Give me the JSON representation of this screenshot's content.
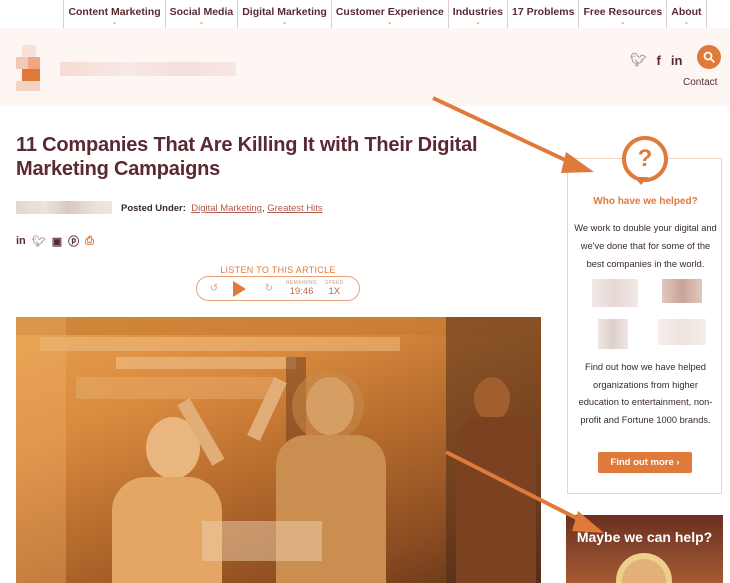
{
  "nav": {
    "items": [
      {
        "label": "Content Marketing"
      },
      {
        "label": "Social Media"
      },
      {
        "label": "Digital Marketing"
      },
      {
        "label": "Customer Experience"
      },
      {
        "label": "Industries"
      },
      {
        "label": "17 Problems"
      },
      {
        "label": "Free Resources"
      },
      {
        "label": "About"
      }
    ]
  },
  "header": {
    "contact_label": "Contact",
    "social_icons": [
      "twitter-icon",
      "facebook-icon",
      "linkedin-icon"
    ],
    "search_icon": "search-icon"
  },
  "article": {
    "title": "11 Companies That Are Killing It with Their Digital Marketing Campaigns",
    "posted_under_label": "Posted Under:",
    "categories": [
      "Digital Marketing",
      "Greatest Hits"
    ],
    "category_separator": ",",
    "share_icons": [
      "linkedin-icon",
      "twitter-icon",
      "facebook-icon",
      "pinterest-icon",
      "print-icon"
    ]
  },
  "player": {
    "listen_label": "LISTEN TO THIS ARTICLE",
    "remaining_label": "REMAINING",
    "remaining_value": "19:46",
    "speed_label": "SPEED",
    "speed_value": "1X"
  },
  "sidebar": {
    "heading": "Who have we helped?",
    "intro": "We work to double your digital and we've done that for some of the best companies in the world.",
    "body": "Find out how we have helped organizations from higher education to entertainment, non-profit and Fortune 1000 brands.",
    "button_label": "Find out more",
    "button_chevron": "›",
    "cta_heading": "Maybe we can help?"
  },
  "colors": {
    "accent": "#e07a3a",
    "brand_dark": "#5a2a32"
  }
}
